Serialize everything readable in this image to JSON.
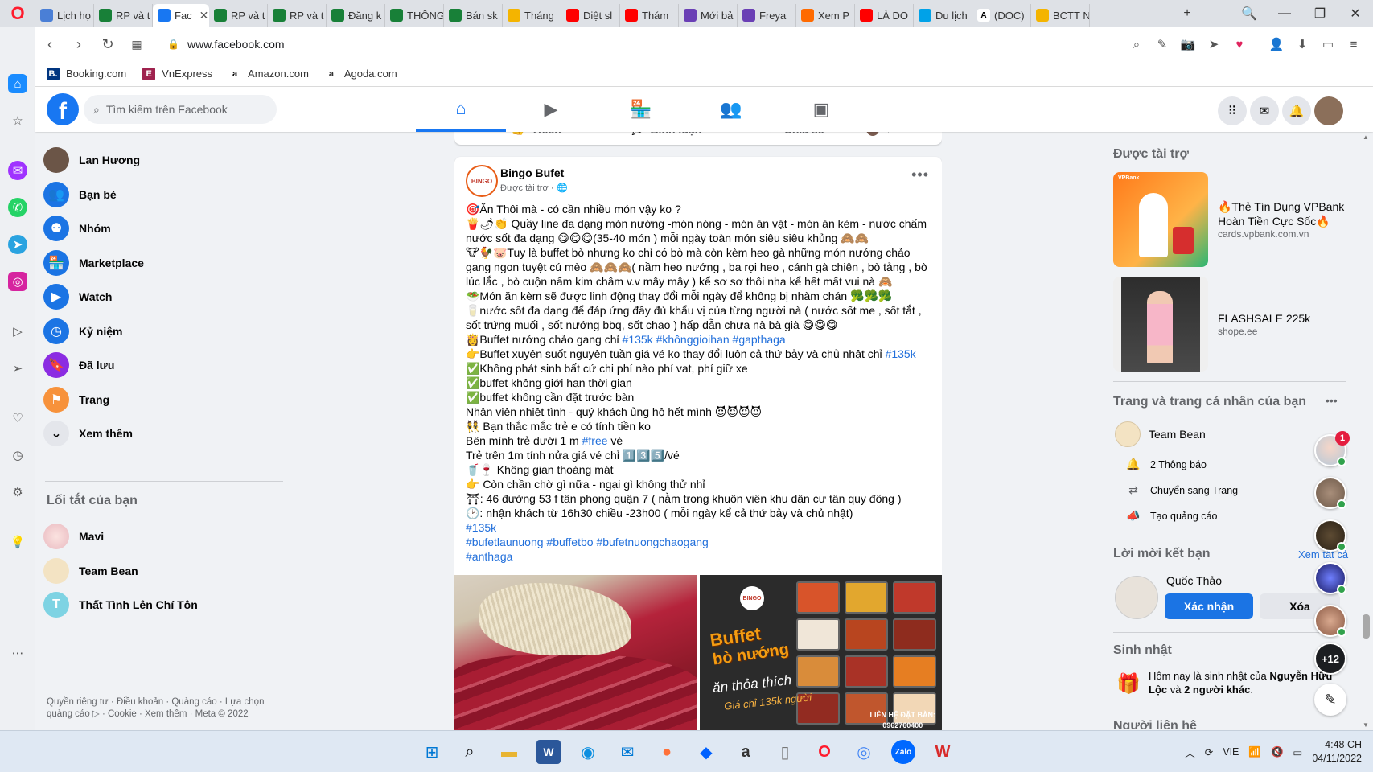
{
  "browser": {
    "tabs": [
      {
        "label": "Lịch họ",
        "icon": "tab-icon-blue"
      },
      {
        "label": "RP và t",
        "icon": "sheets-icon"
      },
      {
        "label": "Fac",
        "icon": "facebook-icon",
        "active": true
      },
      {
        "label": "RP và t",
        "icon": "sheets-icon"
      },
      {
        "label": "RP và t",
        "icon": "sheets-icon"
      },
      {
        "label": "Đăng k",
        "icon": "sheets-icon"
      },
      {
        "label": "THÔNG",
        "icon": "sheets-icon"
      },
      {
        "label": "Bán sk",
        "icon": "sheets-icon"
      },
      {
        "label": "Tháng",
        "icon": "drive-icon"
      },
      {
        "label": "Diệt sl",
        "icon": "youtube-icon"
      },
      {
        "label": "Thám",
        "icon": "youtube-icon"
      },
      {
        "label": "Mới bả",
        "icon": "game-icon"
      },
      {
        "label": "Freya",
        "icon": "game-icon"
      },
      {
        "label": "Xem P",
        "icon": "video-icon"
      },
      {
        "label": "LÀ DO",
        "icon": "youtube-icon"
      },
      {
        "label": "Du lịch",
        "icon": "travel-icon"
      },
      {
        "label": "(DOC)",
        "icon": "doc-a-icon"
      },
      {
        "label": "BCTT N",
        "icon": "drive-icon"
      }
    ],
    "url": "www.facebook.com",
    "bookmarks": [
      {
        "label": "Booking.com",
        "letter": "B."
      },
      {
        "label": "VnExpress",
        "letter": "E"
      },
      {
        "label": "Amazon.com",
        "letter": "a"
      },
      {
        "label": "Agoda.com",
        "letter": "a"
      }
    ]
  },
  "facebook": {
    "search_placeholder": "Tìm kiếm trên Facebook",
    "left_menu": [
      {
        "label": "Lan Hương",
        "icon": "profile-avatar"
      },
      {
        "label": "Bạn bè",
        "icon": "friends-icon"
      },
      {
        "label": "Nhóm",
        "icon": "groups-icon"
      },
      {
        "label": "Marketplace",
        "icon": "marketplace-icon"
      },
      {
        "label": "Watch",
        "icon": "watch-icon"
      },
      {
        "label": "Kỷ niệm",
        "icon": "memories-icon"
      },
      {
        "label": "Đã lưu",
        "icon": "saved-icon"
      },
      {
        "label": "Trang",
        "icon": "pages-icon"
      },
      {
        "label": "Xem thêm",
        "icon": "chevron-down-icon"
      }
    ],
    "shortcuts_title": "Lối tắt của bạn",
    "shortcuts": [
      {
        "label": "Mavi"
      },
      {
        "label": "Team Bean"
      },
      {
        "label": "Thất Tình Lên Chí Tôn",
        "letter": "T"
      }
    ],
    "footer": "Quyền riêng tư · Điều khoản · Quảng cáo · Lựa chọn quảng cáo ▷ · Cookie · Xem thêm · Meta © 2022",
    "prev_post_actions": [
      "Thích",
      "Bình luận",
      "Chia sẻ"
    ],
    "post": {
      "author": "Bingo Bufet",
      "avatar_text": "BINGO",
      "sponsored": "Được tài trợ ·",
      "lines": [
        {
          "text": "🎯Ăn Thôi mà - có cần nhiều món vậy ko ?"
        },
        {
          "text": "🍟🌶👏 Quầy line đa dạng món nướng -món nóng - món ăn vặt - món ăn kèm - nước chấm nước sốt đa dạng 😋😋😋(35-40 món ) mỗi ngày toàn món siêu siêu khủng 🙈🙈",
          "wrap": true
        },
        {
          "text": "🐮🐓🐷Tuy là buffet bò nhưng ko chỉ có bò mà còn kèm heo gà những món nướng chảo gang ngon tuyệt cú mèo 🙈🙈🙈( nầm heo nướng , ba rọi heo , cánh gà chiên , bò tảng , bò lúc lắc , bò cuộn nấm kim châm v.v mây mây ) kể sơ sơ thôi nha kể hết mất vui nà 🙈",
          "wrap": true
        },
        {
          "text": "🥗Món ăn kèm sẽ được linh động thay đổi mỗi ngày để không bị nhàm chán 🥦🥦🥦"
        },
        {
          "text": "🥛nước sốt đa dạng để đáp ứng đầy đủ khẩu vị của từng người nà ( nước sốt me , sốt tắt , sốt trứng muối , sốt nướng bbq, sốt chao ) hấp dẫn chưa nà bà già 😋😋😋",
          "wrap": true
        },
        {
          "text": "👸Buffet nướng chảo gang chỉ ",
          "tags": "#135k #khônggioihan #gapthaga"
        },
        {
          "text": "👉Buffet xuyên suốt nguyên tuần giá vé ko thay đổi luôn cả thứ bảy và chủ nhật chỉ ",
          "tags": "#135k"
        },
        {
          "text": "✅Không phát sinh bất cứ chi phí nào phí vat, phí giữ xe"
        },
        {
          "text": "✅buffet không giới hạn thời gian"
        },
        {
          "text": "✅buffet không cần đặt trước bàn"
        },
        {
          "text": "Nhân viên nhiệt tình - quý khách ủng hộ hết mình 😈😈😈😈"
        },
        {
          "text": "👯 Bạn thắc mắc trẻ e có tính tiền ko"
        },
        {
          "text": "Bên mình trẻ dưới 1 m ",
          "tags": "#free",
          "after": " vé"
        },
        {
          "text": "Trẻ trên 1m tính nửa giá vé chỉ 1️⃣3️⃣5️⃣/vé"
        },
        {
          "text": "🥤🍷 Không gian thoáng mát"
        },
        {
          "text": "👉 Còn chần chờ gì nữa - ngại gì không thử nhỉ"
        },
        {
          "text": "⛩: 46 đường 53 f tân phong quận 7 ( nằm trong khuôn viên khu dân cư tân quy đông )"
        },
        {
          "text": "🕑: nhận khách từ 16h30 chiều -23h00 ( mỗi ngày kể cả thứ bảy và chủ nhật)"
        },
        {
          "text": "",
          "tags": "#135k"
        },
        {
          "text": "",
          "tags": "#bufetlaunuong #buffetbo #bufetnuongchaogang"
        },
        {
          "text": "",
          "tags": "#anthaga"
        }
      ],
      "image_brand": "BINGO",
      "image_title": "Buffet",
      "image_subtitle": "bò nướng",
      "image_slogan": "ăn thỏa thích",
      "image_price": "Giá chỉ 135k người",
      "image_contact_label": "LIÊN HỆ ĐẶT BÀN:",
      "image_contact_phone": "0962760400"
    },
    "sponsored_title": "Được tài trợ",
    "ads": [
      {
        "title": "🔥Thẻ Tín Dụng VPBank Hoàn Tiền Cực Sốc🔥",
        "domain": "cards.vpbank.com.vn",
        "brand": "VPBank"
      },
      {
        "title": "FLASHSALE 225k",
        "domain": "shope.ee"
      }
    ],
    "pages_title": "Trang và trang cá nhân của bạn",
    "page_name": "Team Bean",
    "page_actions": [
      "2 Thông báo",
      "Chuyển sang Trang",
      "Tạo quảng cáo"
    ],
    "friend_requests_title": "Lời mời kết bạn",
    "see_all": "Xem tất cả",
    "friend_name": "Quốc Thảo",
    "confirm_label": "Xác nhận",
    "delete_label": "Xóa",
    "birthday_title": "Sinh nhật",
    "birthday_text_1": "Hôm nay là sinh nhật của ",
    "birthday_name": "Nguyễn Hữu Lộc",
    "birthday_text_2": " và ",
    "birthday_others": "2 người khác",
    "birthday_end": ".",
    "contacts_title_partial": "Người liên hệ",
    "chat_badge": "1",
    "more_contacts": "+12"
  },
  "taskbar": {
    "language": "VIE",
    "time": "4:48 CH",
    "date": "04/11/2022"
  }
}
